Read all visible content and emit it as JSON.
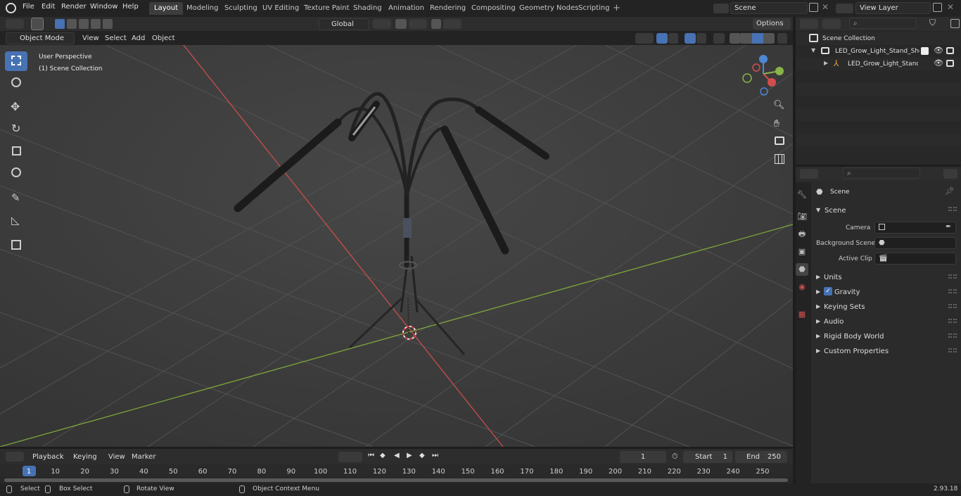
{
  "menu": [
    "File",
    "Edit",
    "Render",
    "Window",
    "Help"
  ],
  "workspaces": [
    "Layout",
    "Modeling",
    "Sculpting",
    "UV Editing",
    "Texture Paint",
    "Shading",
    "Animation",
    "Rendering",
    "Compositing",
    "Geometry Nodes",
    "Scripting"
  ],
  "active_workspace": "Layout",
  "scene_field": "Scene",
  "view_layer_field": "View Layer",
  "transform_orientation": "Global",
  "options_label": "Options",
  "viewport_header": {
    "mode": "Object Mode",
    "items": [
      "View",
      "Select",
      "Add",
      "Object"
    ]
  },
  "viewport_overlay": {
    "line1": "User Perspective",
    "line2": "(1) Scene Collection"
  },
  "outliner": {
    "scene_collection": "Scene Collection",
    "items": [
      {
        "label": "LED_Grow_Light_Stand_Short"
      },
      {
        "label": "LED_Grow_Light_Stand_S"
      }
    ]
  },
  "properties": {
    "header": "Scene",
    "section": "Scene",
    "fields": [
      {
        "label": "Camera"
      },
      {
        "label": "Background Scene"
      },
      {
        "label": "Active Clip"
      }
    ],
    "panels": [
      "Units",
      "Gravity",
      "Keying Sets",
      "Audio",
      "Rigid Body World",
      "Custom Properties"
    ]
  },
  "timeline": {
    "menus": [
      "Playback",
      "Keying",
      "View",
      "Marker"
    ],
    "current_frame": "1",
    "start_label": "Start",
    "start_value": "1",
    "end_label": "End",
    "end_value": "250",
    "ticks": [
      "1",
      "10",
      "20",
      "30",
      "40",
      "50",
      "60",
      "70",
      "80",
      "90",
      "100",
      "110",
      "120",
      "130",
      "140",
      "150",
      "160",
      "170",
      "180",
      "190",
      "200",
      "210",
      "220",
      "230",
      "240",
      "250"
    ]
  },
  "statusbar": {
    "select": "Select",
    "box_select": "Box Select",
    "rotate_view": "Rotate View",
    "context_menu": "Object Context Menu",
    "version": "2.93.18"
  },
  "colors": {
    "accent": "#4772b3",
    "x_axis": "#c94d4d",
    "y_axis": "#7fa63a"
  }
}
